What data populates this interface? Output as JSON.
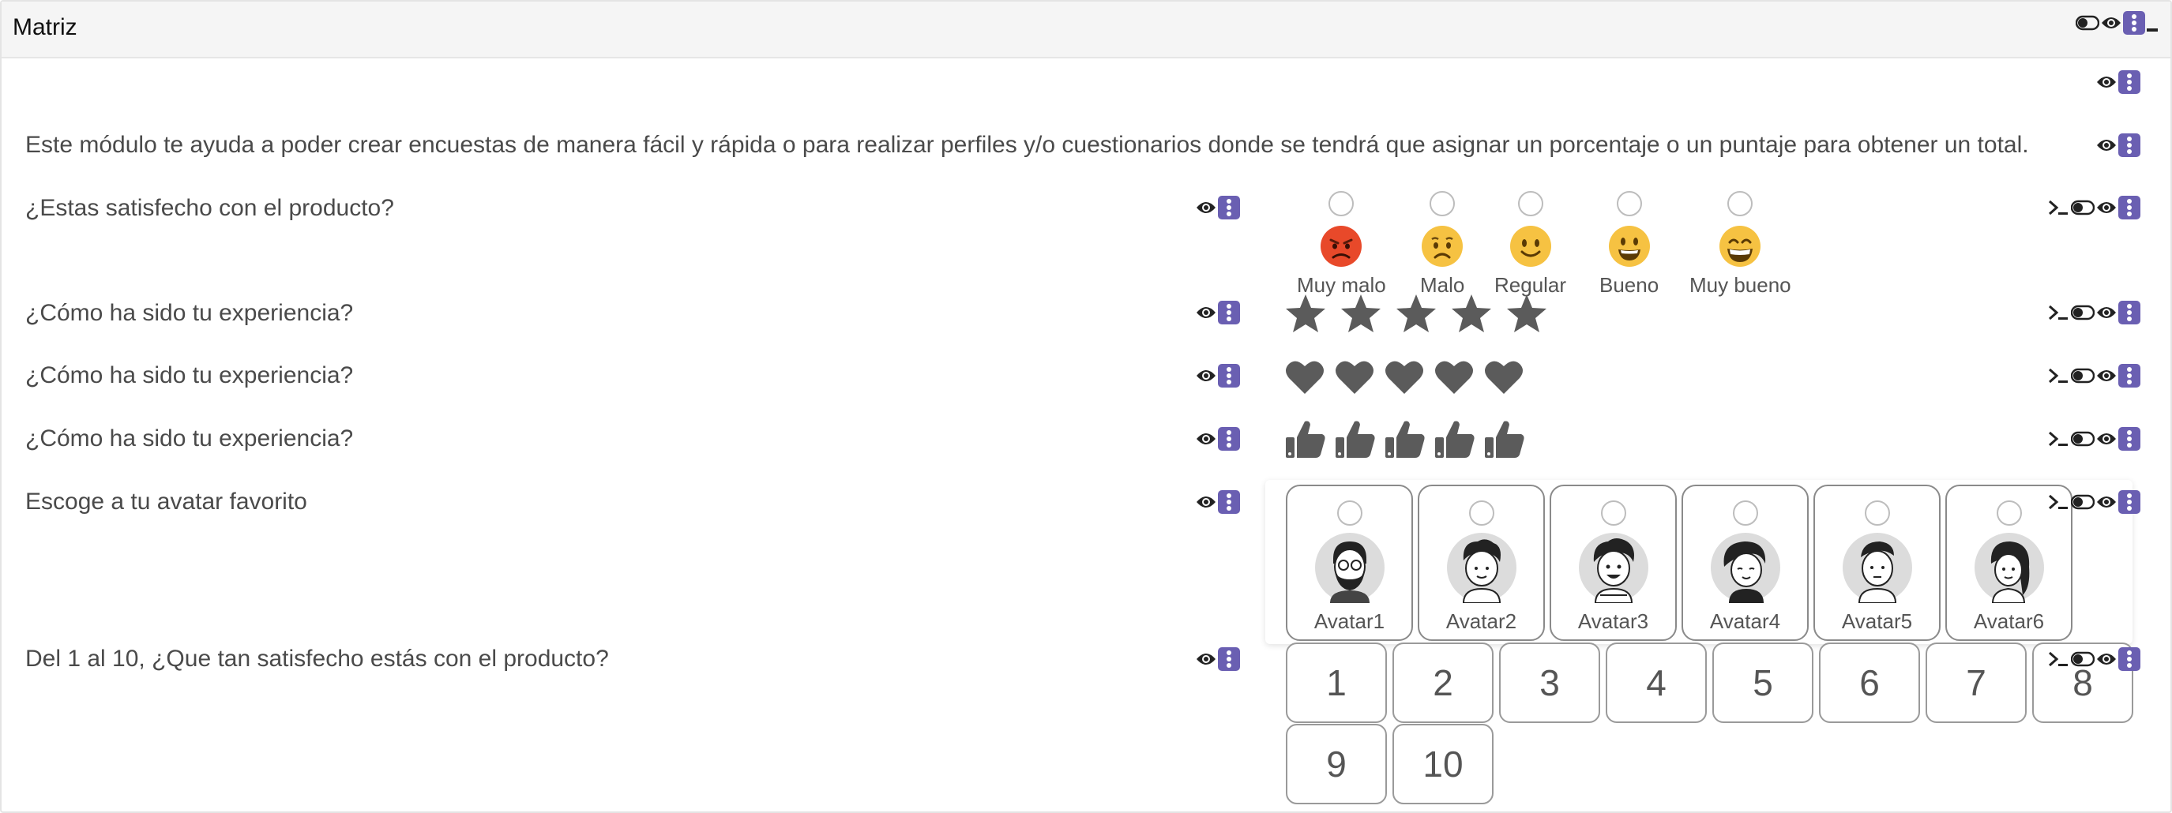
{
  "panel": {
    "title": "Matriz"
  },
  "intro": "Este módulo te ayuda a poder crear encuestas de manera fácil y rápida o para realizar perfiles y/o cuestionarios donde se tendrá que asignar un porcentaje o un puntaje para obtener un total.",
  "questions": [
    {
      "label": "¿Estas satisfecho con el producto?",
      "type": "faces",
      "options": [
        "Muy malo",
        "Malo",
        "Regular",
        "Bueno",
        "Muy bueno"
      ]
    },
    {
      "label": "¿Cómo ha sido tu experiencia?",
      "type": "stars",
      "count": 5
    },
    {
      "label": "¿Cómo ha sido tu experiencia?",
      "type": "hearts",
      "count": 5
    },
    {
      "label": "¿Cómo ha sido tu experiencia?",
      "type": "thumbs",
      "count": 5
    },
    {
      "label": "Escoge a tu avatar favorito",
      "type": "avatars",
      "options": [
        "Avatar1",
        "Avatar2",
        "Avatar3",
        "Avatar4",
        "Avatar5",
        "Avatar6"
      ]
    },
    {
      "label": "Del 1 al 10, ¿Que tan satisfecho estás con el producto?",
      "type": "scale",
      "options": [
        "1",
        "2",
        "3",
        "4",
        "5",
        "6",
        "7",
        "8",
        "9",
        "10"
      ]
    }
  ],
  "icons": {
    "visibility": "eye-icon",
    "menu": "kebab-menu-icon",
    "toggle": "toggle-icon",
    "terminal": "terminal-icon",
    "minimize": "minimize-icon"
  },
  "colors": {
    "accent": "#6a5fb2",
    "icon_gray": "#595959",
    "header_bg": "#f5f5f5"
  }
}
